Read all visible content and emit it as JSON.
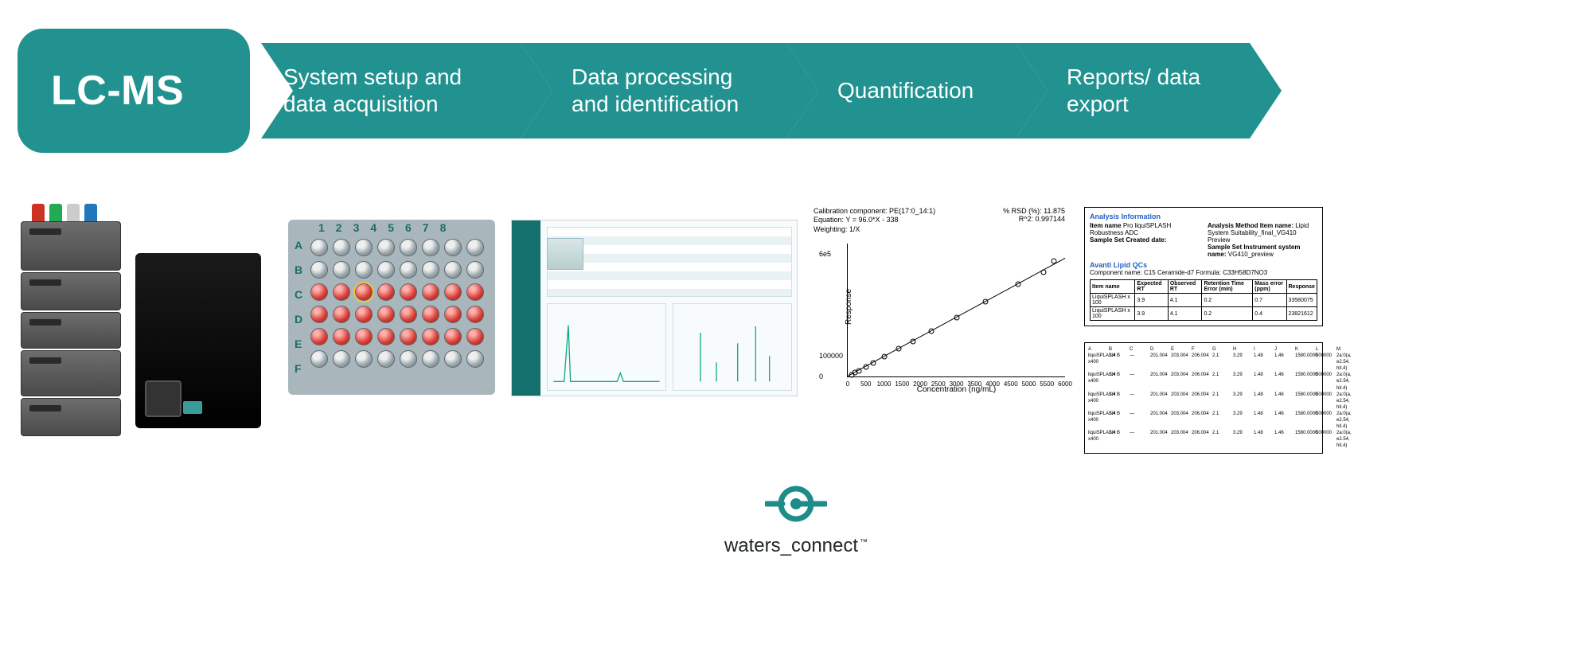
{
  "flow": {
    "lcms": "LC-MS",
    "steps": [
      "System setup and data acquisition",
      "Data processing and identification",
      "Quantification",
      "Reports/ data export"
    ]
  },
  "plate": {
    "columns": [
      "1",
      "2",
      "3",
      "4",
      "5",
      "6",
      "7",
      "8"
    ],
    "rows": [
      "A",
      "B",
      "C",
      "D",
      "E",
      "F"
    ],
    "highlight_col": 3,
    "highlight_row": "C",
    "red_rows": [
      "C",
      "D",
      "E"
    ]
  },
  "chart_data": {
    "type": "scatter",
    "title_lines": [
      "Calibration component: PE(17:0_14:1)",
      "Equation: Y = 96.0*X - 338",
      "Weighting: 1/X"
    ],
    "rsd_label": "% RSD (%): 11.875",
    "r2_label": "R^2: 0.997144",
    "xlabel": "Concentration (ng/mL)",
    "ylabel": "Response",
    "xlim": [
      0,
      6000
    ],
    "ylim": [
      0,
      650000
    ],
    "xticks": [
      0,
      500,
      1000,
      1500,
      2000,
      2500,
      3000,
      3500,
      4000,
      4500,
      5000,
      5500,
      6000
    ],
    "yticks": [
      {
        "v": 0,
        "label": "0"
      },
      {
        "v": 100000,
        "label": "100000"
      },
      {
        "v": 600000,
        "label": "6e5"
      }
    ],
    "points": [
      {
        "x": 100,
        "y": 9000
      },
      {
        "x": 200,
        "y": 18000
      },
      {
        "x": 300,
        "y": 27000
      },
      {
        "x": 500,
        "y": 48000
      },
      {
        "x": 700,
        "y": 67000
      },
      {
        "x": 1000,
        "y": 96000
      },
      {
        "x": 1400,
        "y": 135000
      },
      {
        "x": 1800,
        "y": 172000
      },
      {
        "x": 2300,
        "y": 220000
      },
      {
        "x": 3000,
        "y": 290000
      },
      {
        "x": 3800,
        "y": 365000
      },
      {
        "x": 4700,
        "y": 450000
      },
      {
        "x": 5400,
        "y": 510000
      },
      {
        "x": 5700,
        "y": 565000
      }
    ],
    "fit": {
      "slope": 96.0,
      "intercept": -338
    }
  },
  "report": {
    "section": "Analysis Information",
    "fields": {
      "item_name": {
        "label": "Item name",
        "value": "Pro liquiSPLASH Robustness ADC"
      },
      "method": {
        "label": "Analysis Method Item name:",
        "value": "Lipid System Suitability_final_VG410 Preview"
      },
      "created": {
        "label": "Sample Set Created date:",
        "value": ""
      },
      "instr": {
        "label": "Sample Set Instrument system name:",
        "value": "VG410_preview"
      }
    },
    "qc_heading": "Avanti Lipid QCs",
    "component_line": "Component name: C15 Ceramide-d7  Formula: C33H58D7NO3",
    "table": {
      "headers": [
        "Item name",
        "Expected RT",
        "Observed RT",
        "Retention Time Error (min)",
        "Mass error (ppm)",
        "Response"
      ],
      "rows": [
        [
          "LiquiSPLASH x 100",
          "3.9",
          "4.1",
          "0.2",
          "0.7",
          "33580075"
        ],
        [
          "LiquiSPLASH x 100",
          "3.9",
          "4.1",
          "0.2",
          "0.4",
          "23821612"
        ]
      ]
    }
  },
  "xls": {
    "cols": [
      "A",
      "B",
      "C",
      "D",
      "E",
      "F",
      "G",
      "H",
      "I",
      "J",
      "K",
      "L",
      "M"
    ],
    "rows": [
      [
        "liquiSPLASH x400",
        "1.4 B",
        "—",
        "201.004",
        "203.004",
        "206.004",
        "2.1",
        "3.29",
        "1.48",
        "1.46",
        "1580.0000",
        "500000",
        "2a:0(a, e2.54, hit.4)"
      ],
      [
        "liquiSPLASH x400",
        "1.4 B",
        "—",
        "201.004",
        "203.004",
        "206.004",
        "2.1",
        "3.29",
        "1.48",
        "1.46",
        "1580.0000",
        "500000",
        "2a:0(a, e2.54, hit.4)"
      ],
      [
        "liquiSPLASH x400",
        "1.4 B",
        "—",
        "201.004",
        "203.004",
        "206.004",
        "2.1",
        "3.29",
        "1.48",
        "1.46",
        "1580.0000",
        "500000",
        "2a:0(a, e2.54, hit.4)"
      ],
      [
        "liquiSPLASH x400",
        "1.4 B",
        "—",
        "201.004",
        "203.004",
        "206.004",
        "2.1",
        "3.29",
        "1.48",
        "1.46",
        "1580.0000",
        "500000",
        "2a:0(a, e2.54, hit.4)"
      ],
      [
        "liquiSPLASH x400",
        "1.4 B",
        "—",
        "201.004",
        "203.004",
        "206.004",
        "2.1",
        "3.29",
        "1.48",
        "1.46",
        "1580.0000",
        "500000",
        "2a:0(a, e2.54, hit.4)"
      ]
    ]
  },
  "logo": {
    "text": "waters_connect"
  },
  "colors": {
    "teal": "#21928f"
  }
}
